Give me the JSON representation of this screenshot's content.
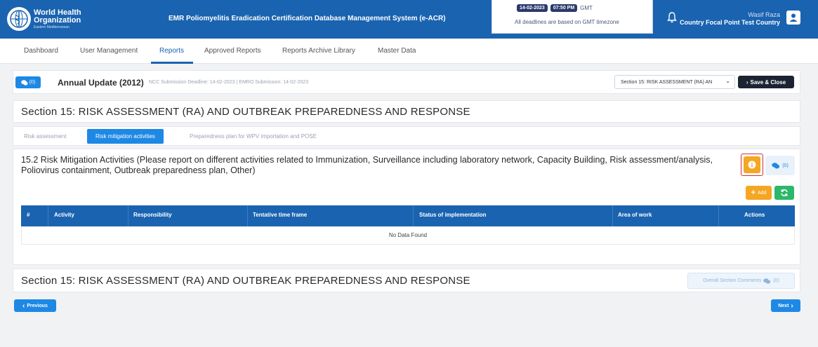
{
  "header": {
    "logo": {
      "line1": "World Health",
      "line2": "Organization",
      "line3": "Eastern Mediterranean"
    },
    "app_title": "EMR Poliomyelitis Eradication Certification Database Management System (e-ACR)",
    "date": "14-02-2023",
    "time": "07:50 PM",
    "timezone": "GMT",
    "deadline_note": "All deadlines are based on GMT timezone",
    "user_name": "Wasif Raza",
    "user_role": "Country Focal Point Test Country",
    "bell_icon": "bell-icon",
    "avatar_icon": "user-icon"
  },
  "nav": {
    "items": [
      {
        "label": "Dashboard",
        "active": false
      },
      {
        "label": "User Management",
        "active": false
      },
      {
        "label": "Reports",
        "active": true
      },
      {
        "label": "Approved Reports",
        "active": false
      },
      {
        "label": "Reports Archive Library",
        "active": false
      },
      {
        "label": "Master Data",
        "active": false
      }
    ]
  },
  "report_bar": {
    "comment_count": "(0)",
    "title": "Annual Update (2012)",
    "deadlines": "NCC Submission Deadline: 14-02-2023 | EMRO Submission: 14-02-2023",
    "section_select": "Section 15: RISK ASSESSMENT (RA) AN",
    "save_close": "Save & Close"
  },
  "section": {
    "title": "Section 15: RISK ASSESSMENT (RA) AND OUTBREAK PREPAREDNESS AND RESPONSE",
    "tabs": [
      {
        "label": "Risk assessment",
        "active": false
      },
      {
        "label": "Risk mitigation activities",
        "active": true
      },
      {
        "label": "Preparedness plan for WPV importation and POSE",
        "active": false
      }
    ]
  },
  "question": {
    "text": "15.2 Risk Mitigation Activities (Please report on different activities related to Immunization, Surveillance including laboratory network, Capacity Building, Risk assessment/analysis, Poliovirus containment, Outbreak preparedness plan, Other)",
    "comment_count": "(0)",
    "add_label": "Add"
  },
  "table": {
    "columns": [
      "#",
      "Activity",
      "Responsibility",
      "Tentative time frame",
      "Status of implementation",
      "Area of work",
      "Actions"
    ],
    "empty_text": "No Data Found"
  },
  "footer": {
    "overall_comments": "Overall Section Comments",
    "overall_count": "(0)",
    "previous": "Previous",
    "next": "Next"
  },
  "colors": {
    "primary": "#1a63b0",
    "accent": "#1e88e5",
    "warning": "#f5a623",
    "success": "#2db76a",
    "dark": "#1c2433"
  }
}
